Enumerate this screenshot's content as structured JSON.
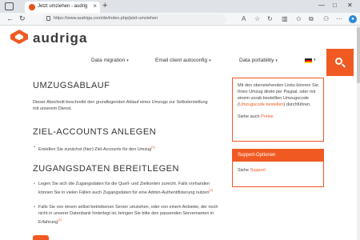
{
  "browser": {
    "tab_title": "Jetzt umziehen - audriga - data",
    "tab_close": "×",
    "new_tab": "+",
    "url": "https://www.audriga.com/de/index.php/jetzt-umziehen",
    "window_controls": [
      "—",
      "□",
      "✕"
    ],
    "nav": {
      "back": "←",
      "reload": "↻"
    }
  },
  "site": {
    "brand": "audriga",
    "brand_color": "#f05a22",
    "nav_items": [
      {
        "label": "Data migration",
        "caret": "▾"
      },
      {
        "label": "Email client autoconfig",
        "caret": "▾"
      },
      {
        "label": "Data portability",
        "caret": "▾"
      }
    ],
    "lang_caret": "▾"
  },
  "content": {
    "h_umzug": "UMZUGSABLAUF",
    "p_umzug": "Dieser Abschnitt beschreibt den grundlegenden Ablauf eines Umzugs zur Selbsterstellung mit unserem Dienst.",
    "h_ziel": "ZIEL-ACCOUNTS ANLEGEN",
    "bullet_ziel": "Erstellen Sie zunächst (hier) Ziel-Accounts für den Umzug",
    "bullet_ziel_sup": "[1]",
    "h_zugang": "ZUGANGSDATEN BEREITLEGEN",
    "bullet_zugang_1": "Legen Sie sich die Zugangsdaten für die Quell- und Zielkonten zurecht. Falls vorhanden können Sie in vielen Fällen auch Zugangsdaten für eine Admin-Authentifizierung nutzen",
    "bullet_zugang_1_sup": "[2]",
    "bullet_zugang_2": "Falls Sie von einem selbst betriebenen Server umziehen, oder von einem Anbieter, der noch nicht in unserer Datenbank hinterlegt ist, bringen Sie bitte den passenden Servernamen in Erfahrung",
    "bullet_zugang_2_sup": "[3]"
  },
  "sidebar": {
    "box1_text": "Mit den obenstehenden Links können Sie Ihren Umzug direkt per Paypal, oder mit einem vorab bestellten Umzugscode (",
    "box1_link": "Umzugscode bestellen",
    "box1_text_end": ") durchführen.",
    "box1_after": "Siehe auch",
    "box1_after_link": "Preise",
    "box2_head": "Support-Optionen",
    "box2_body": "Siehe",
    "box2_link": "Support"
  }
}
